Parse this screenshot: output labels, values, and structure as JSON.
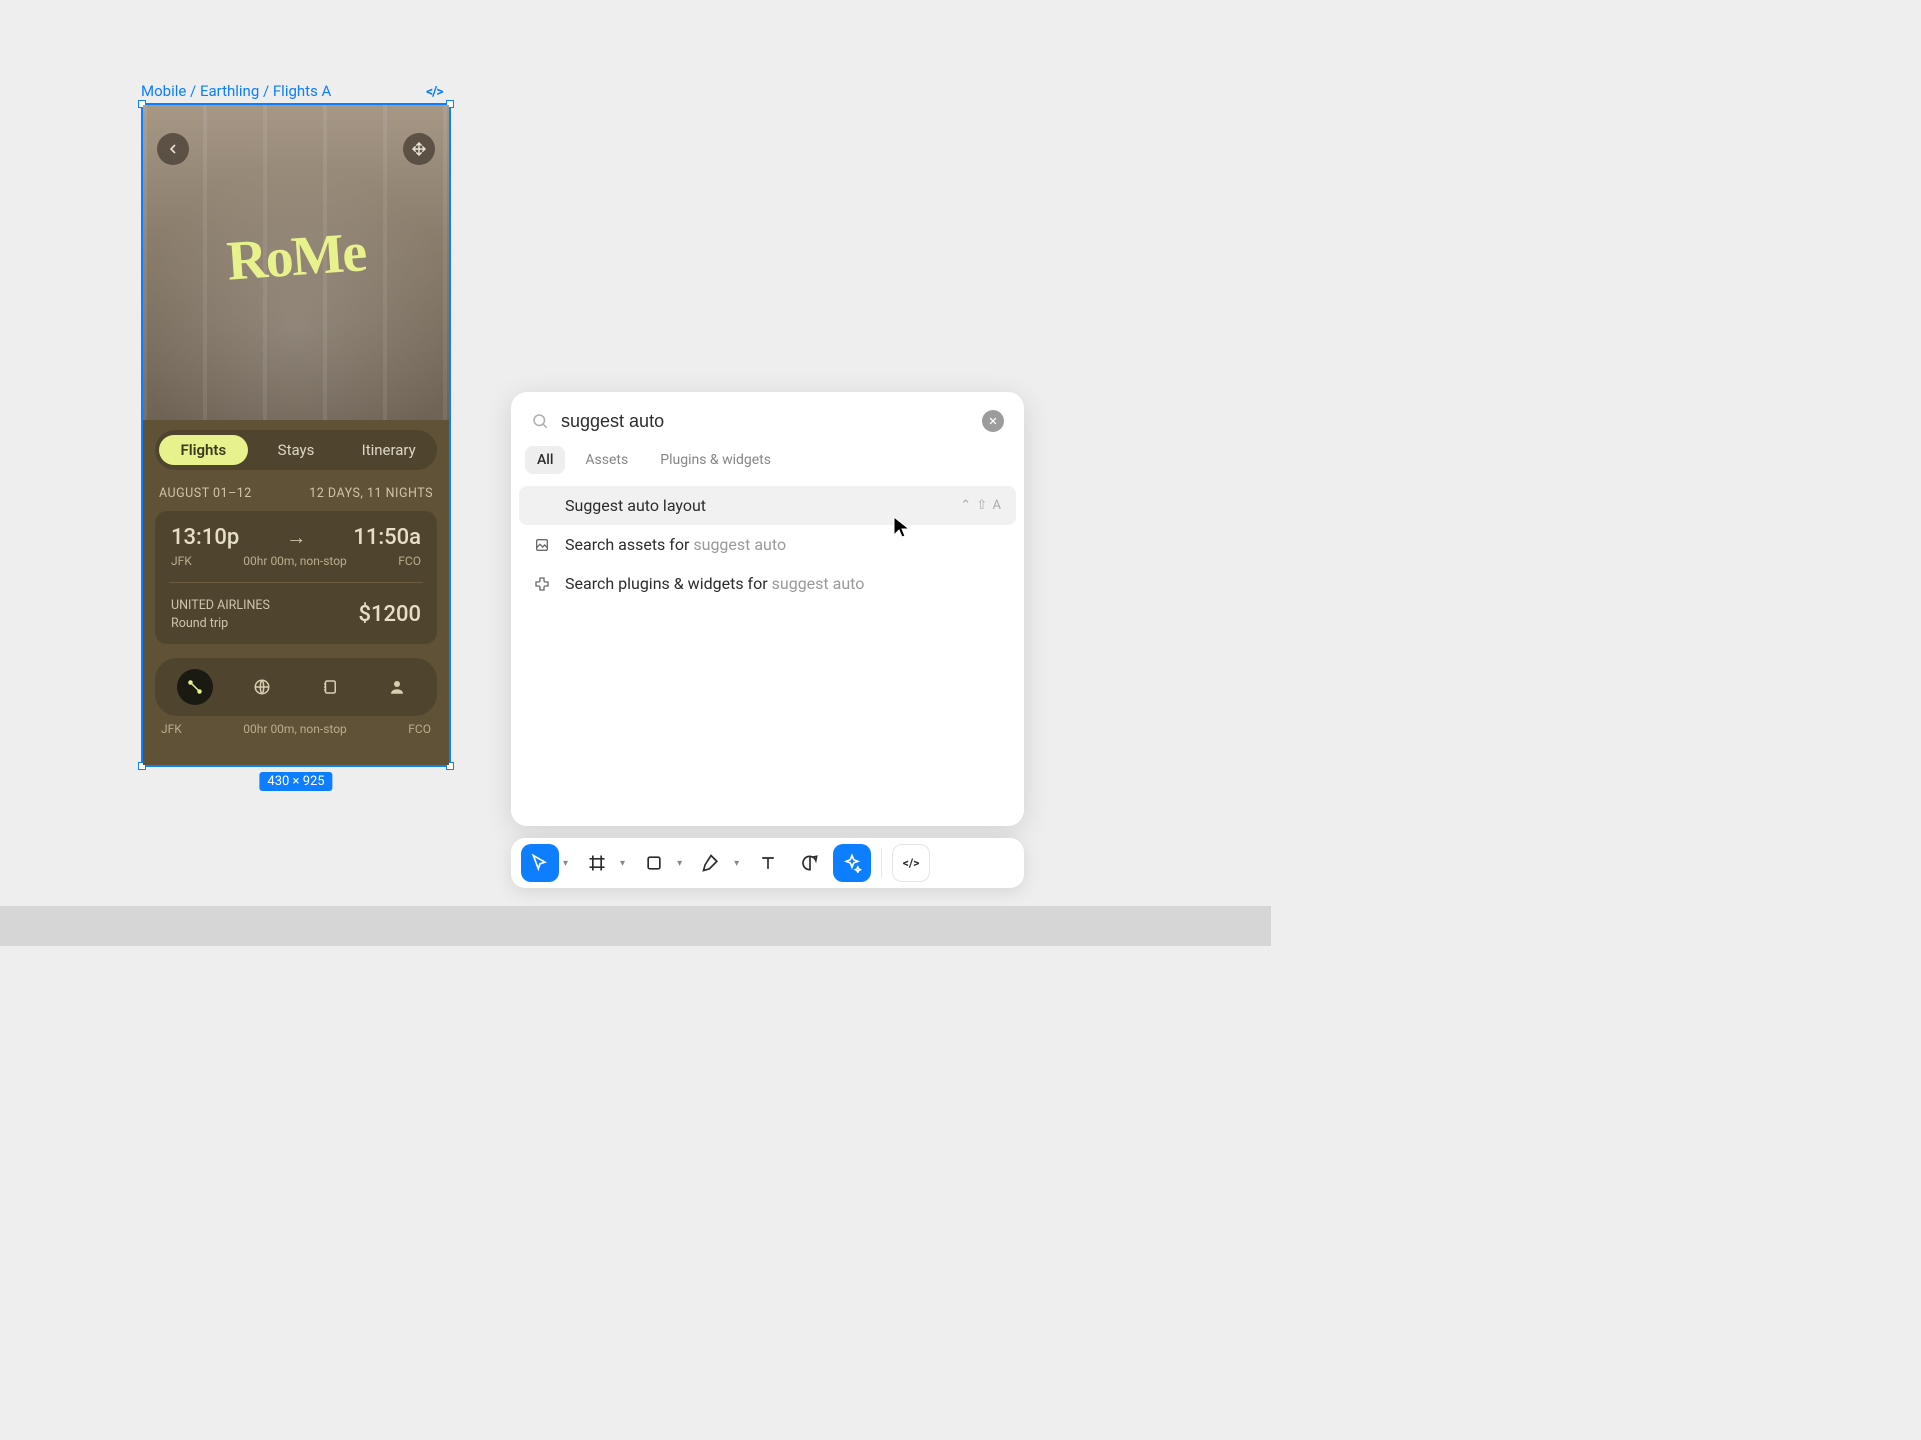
{
  "frame": {
    "label": "Mobile / Earthling / Flights A",
    "dimensions": "430 × 925"
  },
  "app": {
    "heroTitle": "RoMe",
    "tabs": {
      "flights": "Flights",
      "stays": "Stays",
      "itinerary": "Itinerary"
    },
    "dates": {
      "range": "AUGUST 01–12",
      "duration": "12 DAYS, 11 NIGHTS"
    },
    "flight": {
      "depTime": "13:10p",
      "arrTime": "11:50a",
      "depCode": "JFK",
      "stops": "00hr 00m, non-stop",
      "arrCode": "FCO",
      "airline": "UNITED AIRLINES",
      "trip": "Round trip",
      "price": "$1200"
    },
    "footerCodes": {
      "left": "JFK",
      "mid": "00hr 00m, non-stop",
      "right": "FCO"
    }
  },
  "palette": {
    "query": "suggest auto",
    "filters": {
      "all": "All",
      "assets": "Assets",
      "plugins": "Plugins & widgets"
    },
    "results": {
      "suggest": {
        "label": "Suggest auto layout",
        "shortcut": "⌃ ⇧ A"
      },
      "assetsPrefix": "Search assets for ",
      "pluginsPrefix": "Search plugins & widgets for ",
      "term": "suggest auto"
    }
  }
}
